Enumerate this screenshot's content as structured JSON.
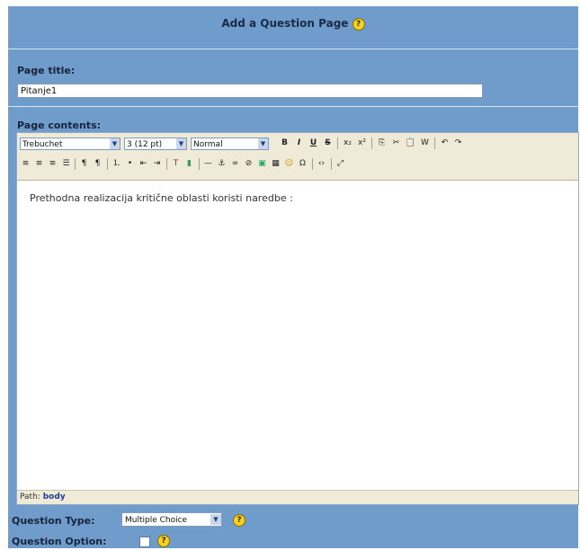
{
  "header": {
    "title": "Add a Question Page",
    "help_icon": "question-help-icon"
  },
  "page_title": {
    "label": "Page title:",
    "value": "Pitanje1"
  },
  "page_contents": {
    "label": "Page contents:"
  },
  "editor": {
    "font_family": "Trebuchet",
    "font_size": "3 (12 pt)",
    "format": "Normal",
    "content": "Prethodna realizacija kritične oblasti koristi naredbe :",
    "path_label": "Path:",
    "path_value": "body",
    "toolbar_row1": [
      "bold-icon",
      "italic-icon",
      "underline-icon",
      "strikethrough-icon",
      "subscript-icon",
      "superscript-icon",
      "copy-icon",
      "cut-icon",
      "paste-icon",
      "paste-word-icon",
      "undo-icon",
      "redo-icon"
    ],
    "toolbar_row2": [
      "align-left-icon",
      "align-center-icon",
      "align-right-icon",
      "justify-icon",
      "ltr-icon",
      "rtl-icon",
      "ordered-list-icon",
      "unordered-list-icon",
      "outdent-icon",
      "indent-icon",
      "text-color-icon",
      "bg-color-icon",
      "horizontal-rule-icon",
      "anchor-icon",
      "link-icon",
      "unlink-icon",
      "image-icon",
      "table-icon",
      "smiley-icon",
      "special-char-icon",
      "html-source-icon",
      "fullscreen-icon"
    ]
  },
  "question_type": {
    "label": "Question Type:",
    "value": "Multiple Choice"
  },
  "question_option": {
    "label": "Question Option:",
    "checked": false
  },
  "colors": {
    "panel": "#6f9ccb",
    "toolbar": "#efebd8",
    "help": "#f6d21c"
  }
}
